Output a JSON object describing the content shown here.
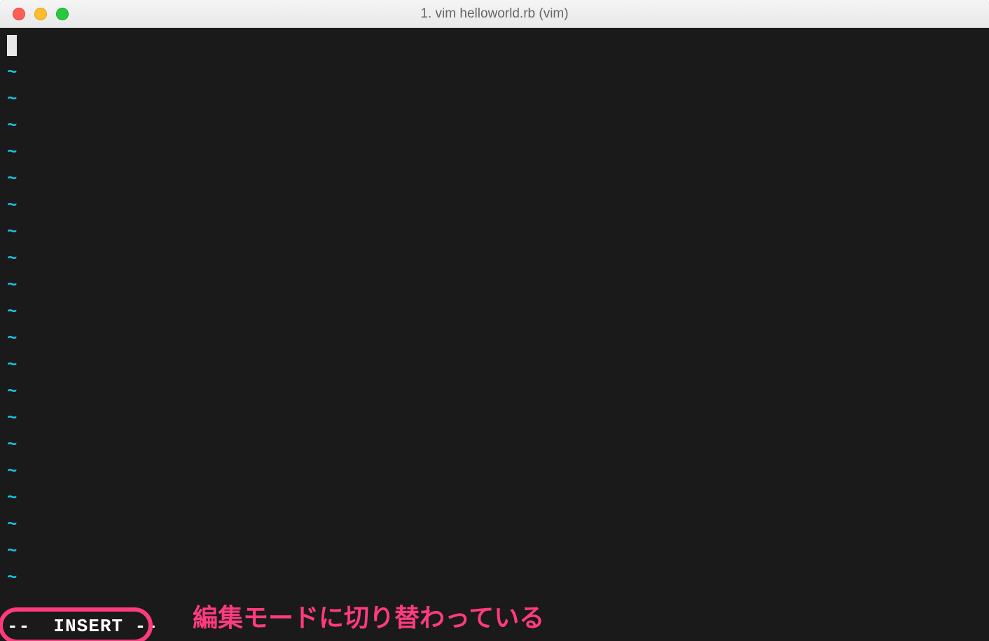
{
  "window": {
    "title": "1. vim helloworld.rb (vim)"
  },
  "editor": {
    "tilde": "~",
    "tilde_count": 20,
    "status_mode": "--  INSERT --"
  },
  "annotation": {
    "label": "編集モードに切り替わっている"
  },
  "colors": {
    "tilde": "#15c5e8",
    "annotation": "#ff3b7f",
    "editor_bg": "#1a1a1a"
  }
}
